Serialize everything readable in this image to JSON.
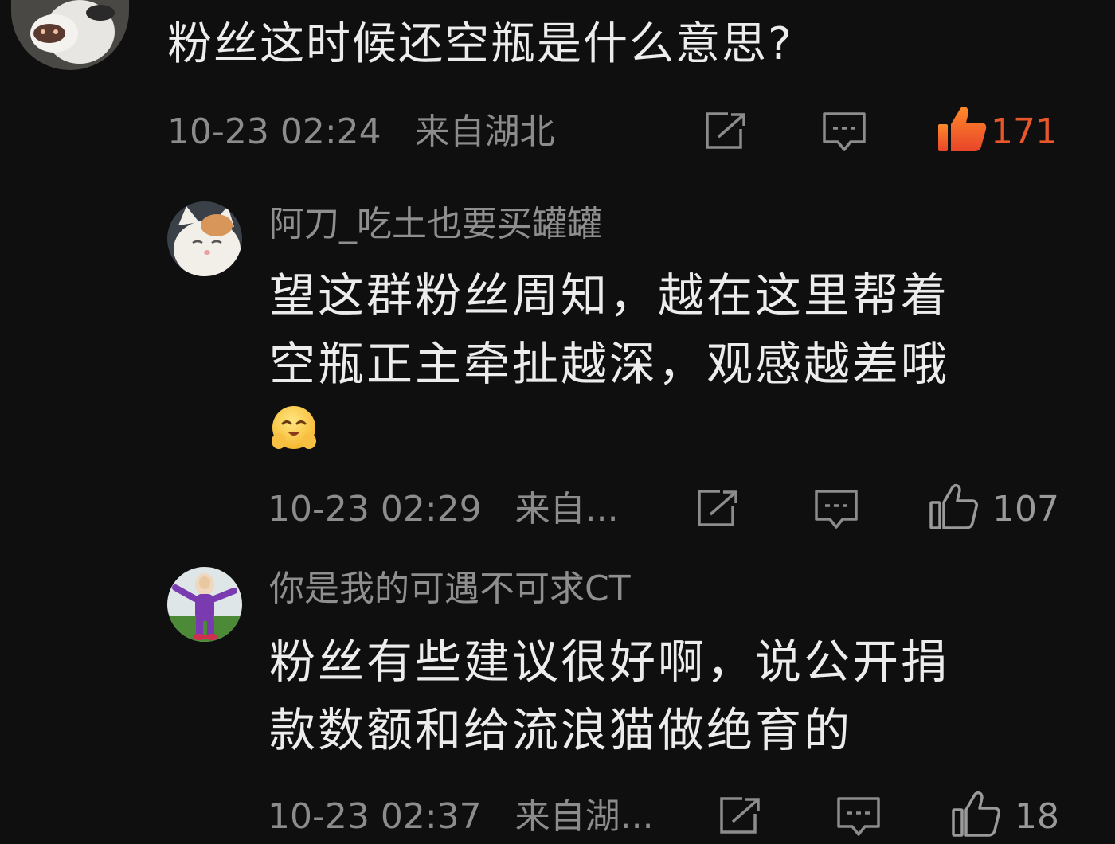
{
  "colors": {
    "background": "#0f0f0f",
    "primary_text": "#ececec",
    "secondary_text": "#8c8c8c",
    "liked_accent": "#e8572a"
  },
  "main_comment": {
    "text": "粉丝这时候还空瓶是什么意思?",
    "timestamp": "10-23 02:24",
    "location": "来自湖北",
    "likes": "171",
    "liked": true,
    "icons": [
      "share-icon",
      "reply-comment-icon",
      "thumbs-up-icon"
    ]
  },
  "replies": [
    {
      "username": "阿刀_吃土也要买罐罐",
      "text_line1": "望这群粉丝周知，越在这里帮着",
      "text_line2": "空瓶正主牵扯越深，观感越差哦",
      "emoji": "hugging-face-emoji",
      "timestamp": "10-23 02:29",
      "location": "来自...",
      "likes": "107"
    },
    {
      "username": "你是我的可遇不可求CT",
      "text_line1": "粉丝有些建议很好啊，说公开捐",
      "text_line2": "款数额和给流浪猫做绝育的",
      "timestamp": "10-23 02:37",
      "location": "来自湖...",
      "likes": "18"
    }
  ]
}
